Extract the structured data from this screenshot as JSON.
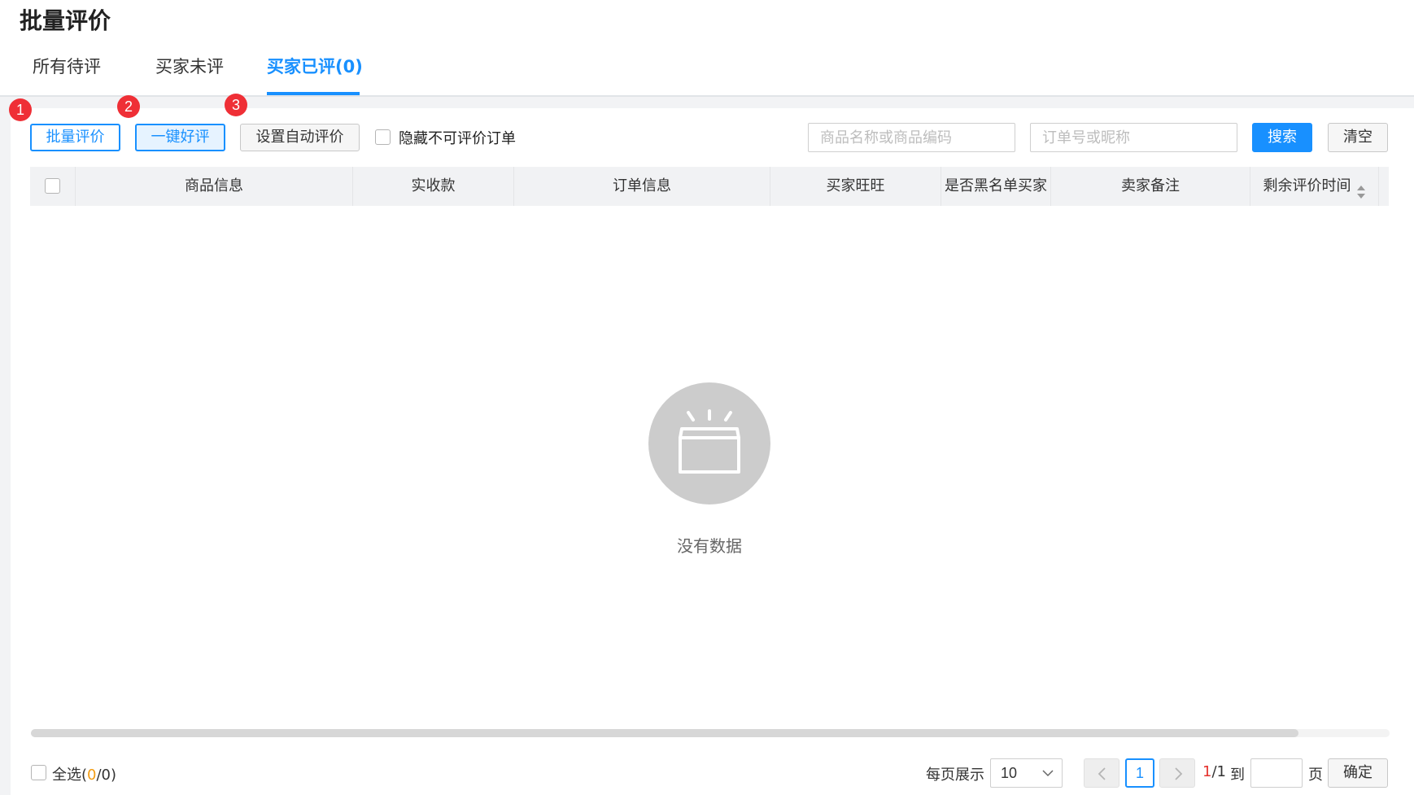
{
  "page": {
    "title": "批量评价"
  },
  "tabs": [
    {
      "label": "所有待评"
    },
    {
      "label": "买家未评"
    },
    {
      "label": "买家已评(0)",
      "active": true
    }
  ],
  "toolbar": {
    "badges": [
      "1",
      "2",
      "3"
    ],
    "batch_review_label": "批量评价",
    "one_click_good_label": "一键好评",
    "auto_review_label": "设置自动评价",
    "hide_label": "隐藏不可评价订单",
    "product_search_placeholder": "商品名称或商品编码",
    "order_search_placeholder": "订单号或昵称",
    "search_label": "搜索",
    "clear_label": "清空"
  },
  "table": {
    "columns": [
      "商品信息",
      "实收款",
      "订单信息",
      "买家旺旺",
      "是否黑名单买家",
      "卖家备注",
      "剩余评价时间"
    ],
    "empty_text": "没有数据"
  },
  "footer": {
    "select_all_prefix": "全选(",
    "select_all_count": "0",
    "select_all_suffix": "/0)",
    "page_size_label": "每页展示",
    "page_size_value": "10",
    "current_page": "1",
    "page_info_current": "1",
    "page_info_total": "/1",
    "goto_label": "到",
    "page_unit": "页",
    "confirm_label": "确定"
  },
  "colors": {
    "accent": "#1890ff",
    "badge": "#ef2f36",
    "empty_icon": "#cccccc",
    "count_highlight": "#f39c12"
  }
}
